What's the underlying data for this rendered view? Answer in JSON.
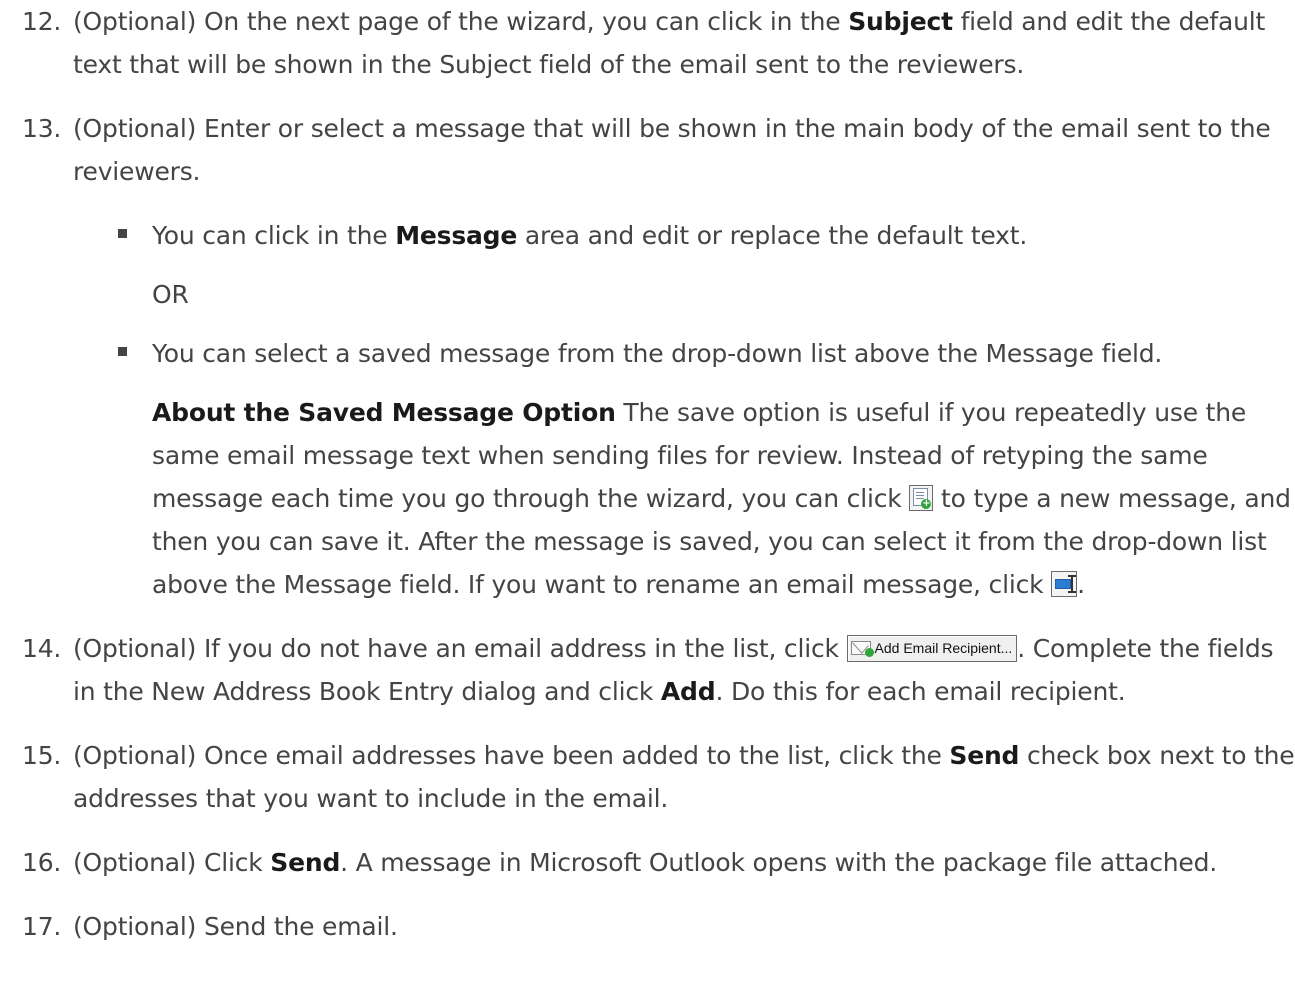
{
  "steps": [
    {
      "number": "12.",
      "prefix": "(Optional) On the next page of the wizard, you can click in the ",
      "bold": "Subject",
      "suffix": " field and edit the default text that will be shown in the Subject field of the email sent to the reviewers."
    },
    {
      "number": "13.",
      "text": "(Optional) Enter or select a message that will be shown in the main body of the email sent to the reviewers.",
      "bullet1": {
        "prefix": "You can click in the ",
        "bold": "Message",
        "suffix": " area and edit or replace the default text."
      },
      "or_text": "OR",
      "bullet2": {
        "text": "You can select a saved message from the drop-down list above the Message field."
      },
      "note": {
        "bold": "About the Saved Message Option",
        "part1": " The save option is useful if you repeatedly use the same email message text when sending files for review. Instead of retyping the same message each time you go through the wizard, you can click ",
        "part2": " to type a new message, and then you can save it. After the message is saved, you can select it from the drop-down list above the Message field. If you want to rename an email message, click ",
        "part3": "."
      }
    },
    {
      "number": "14.",
      "part1": "(Optional) If you do not have an email address in the list, click ",
      "button_label": "Add Email Recipient...",
      "part2": ". Complete the fields in the New Address Book Entry dialog and click ",
      "bold": "Add",
      "part3": ". Do this for each email recipient."
    },
    {
      "number": "15.",
      "prefix": "(Optional) Once email addresses have been added to the list, click the ",
      "bold": "Send",
      "suffix": " check box next to the addresses that you want to include in the email."
    },
    {
      "number": "16.",
      "prefix": "(Optional) Click ",
      "bold": "Send",
      "suffix": ". A message in Microsoft Outlook opens with the package file attached."
    },
    {
      "number": "17.",
      "text": "(Optional) Send the email."
    }
  ],
  "icons": {
    "new_message": "new-message-icon",
    "rename_message": "rename-icon",
    "add_recipient": "envelope-add-icon"
  },
  "colors": {
    "text": "#444444",
    "bold_text": "#1a1a1a"
  }
}
